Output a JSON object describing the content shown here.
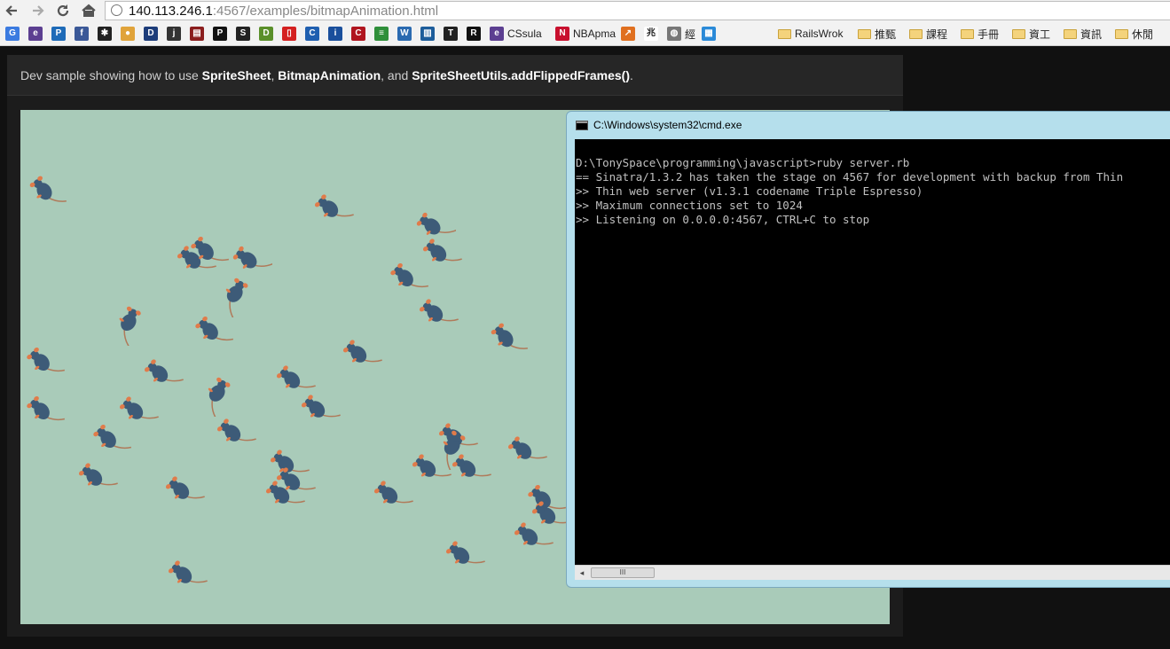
{
  "browser": {
    "url_host": "140.113.246.1",
    "url_rest": ":4567/examples/bitmapAnimation.html",
    "bookmarks": [
      {
        "icon": "google-icon",
        "color": "#3b7be0",
        "glyph": "G",
        "label": ""
      },
      {
        "icon": "eclipse-icon",
        "color": "#5c3f91",
        "glyph": "e",
        "label": ""
      },
      {
        "icon": "p-icon",
        "color": "#1e6bb8",
        "glyph": "P",
        "label": ""
      },
      {
        "icon": "facebook-icon",
        "color": "#3b5998",
        "glyph": "f",
        "label": ""
      },
      {
        "icon": "ninja-icon",
        "color": "#222222",
        "glyph": "✱",
        "label": ""
      },
      {
        "icon": "duck-icon",
        "color": "#e0a33a",
        "glyph": "●",
        "label": ""
      },
      {
        "icon": "d-icon",
        "color": "#1d3d7a",
        "glyph": "D",
        "label": ""
      },
      {
        "icon": "jtv-icon",
        "color": "#333333",
        "glyph": "j",
        "label": ""
      },
      {
        "icon": "news-icon",
        "color": "#8b1e1e",
        "glyph": "▤",
        "label": ""
      },
      {
        "icon": "p2-icon",
        "color": "#111111",
        "glyph": "P",
        "label": ""
      },
      {
        "icon": "sv-icon",
        "color": "#222222",
        "glyph": "S",
        "label": ""
      },
      {
        "icon": "do-icon",
        "color": "#5a8f2a",
        "glyph": "D",
        "label": ""
      },
      {
        "icon": "red-icon",
        "color": "#d42020",
        "glyph": "▯",
        "label": ""
      },
      {
        "icon": "c-icon",
        "color": "#1f5fb0",
        "glyph": "C",
        "label": ""
      },
      {
        "icon": "it-icon",
        "color": "#1a4f9c",
        "glyph": "i",
        "label": ""
      },
      {
        "icon": "c2-icon",
        "color": "#b0151f",
        "glyph": "C",
        "label": ""
      },
      {
        "icon": "reader-icon",
        "color": "#2f8f3a",
        "glyph": "≡",
        "label": ""
      },
      {
        "icon": "w3-icon",
        "color": "#2a6ab0",
        "glyph": "W",
        "label": ""
      },
      {
        "icon": "trello-icon",
        "color": "#1d5d9b",
        "glyph": "▥",
        "label": ""
      },
      {
        "icon": "tw-icon",
        "color": "#222222",
        "glyph": "T",
        "label": ""
      },
      {
        "icon": "r-icon",
        "color": "#111111",
        "glyph": "R",
        "label": ""
      },
      {
        "icon": "cssula-icon",
        "color": "#5c3f91",
        "glyph": "e",
        "label": "CSsula"
      },
      {
        "icon": "nba-icon",
        "color": "#c8102e",
        "glyph": "N",
        "label": "NBApma"
      },
      {
        "icon": "chart-icon",
        "color": "#e07020",
        "glyph": "↗",
        "label": ""
      },
      {
        "icon": "chinese-char-icon",
        "color": "#ffffff",
        "glyph": "兆",
        "label": ""
      },
      {
        "icon": "globe-icon",
        "color": "#777777",
        "glyph": "◍",
        "label": "經"
      },
      {
        "icon": "windows-icon",
        "color": "#2a8ad8",
        "glyph": "▦",
        "label": ""
      }
    ],
    "folders": [
      "RailsWrok",
      "推甄",
      "課程",
      "手冊",
      "資工",
      "資訊",
      "休閒"
    ]
  },
  "page": {
    "intro_prefix": "Dev sample showing how to use ",
    "sprite_sheet": "SpriteSheet",
    "sep1": ", ",
    "bitmap_animation": "BitmapAnimation",
    "sep2": ", and ",
    "flipped_frames": "SpriteSheetUtils.addFlippedFrames()",
    "suffix": "."
  },
  "cmd": {
    "title": "C:\\Windows\\system32\\cmd.exe",
    "lines": [
      "D:\\TonySpace\\programming\\javascript>ruby server.rb",
      "== Sinatra/1.3.2 has taken the stage on 4567 for development with backup from Thin",
      ">> Thin web server (v1.3.1 codename Triple Espresso)",
      ">> Maximum connections set to 1024",
      ">> Listening on 0.0.0.0:4567, CTRL+C to stop"
    ],
    "scroll_thumb": "III"
  },
  "colors": {
    "stage_bg": "#a9cbb9",
    "rat_body": "#3d5b78",
    "rat_ear": "#e07b4a",
    "rat_tail": "#b07a5a"
  }
}
